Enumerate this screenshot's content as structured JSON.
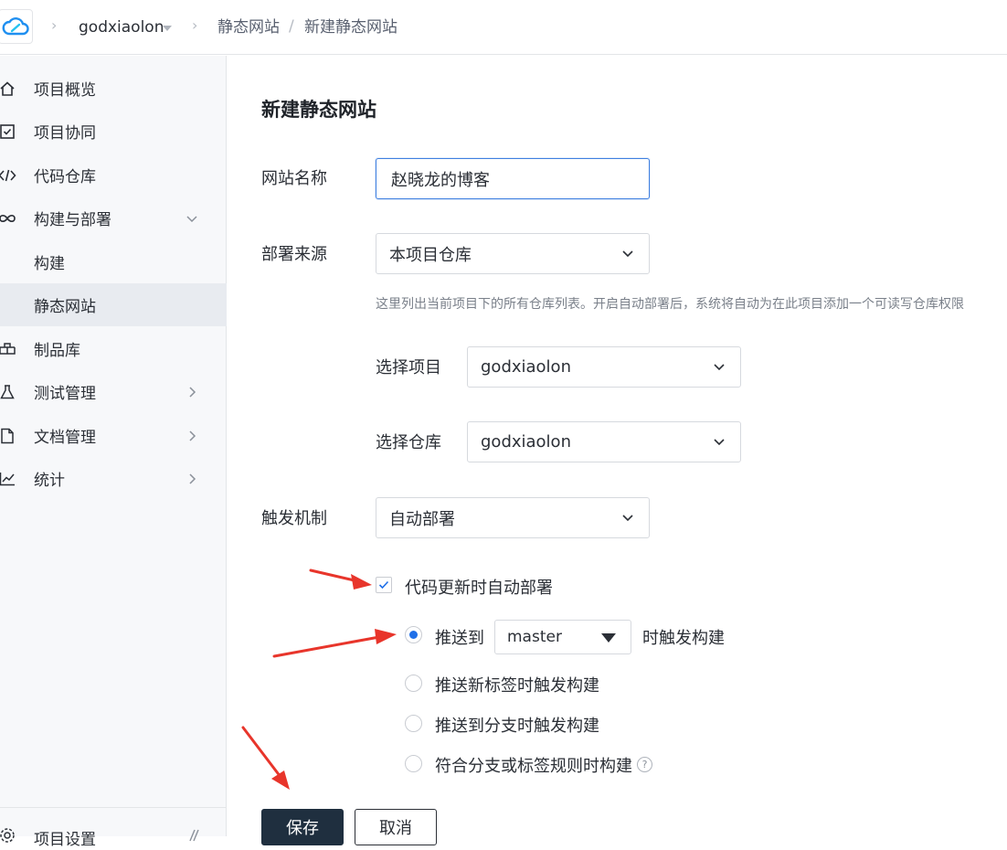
{
  "header": {
    "project_name": "godxiaolon",
    "breadcrumb": [
      "静态网站",
      "新建静态网站"
    ],
    "slash": "/"
  },
  "sidebar": {
    "items": [
      {
        "label": "项目概览",
        "icon": "home-icon"
      },
      {
        "label": "项目协同",
        "icon": "checkbox-icon"
      },
      {
        "label": "代码仓库",
        "icon": "code-icon"
      },
      {
        "label": "构建与部署",
        "icon": "infinity-icon",
        "expanded": true
      },
      {
        "label": "构建",
        "sub": true
      },
      {
        "label": "静态网站",
        "sub": true,
        "active": true
      },
      {
        "label": "制品库",
        "icon": "package-icon"
      },
      {
        "label": "测试管理",
        "icon": "flask-icon"
      },
      {
        "label": "文档管理",
        "icon": "document-icon"
      },
      {
        "label": "统计",
        "icon": "chart-icon"
      }
    ],
    "footer_label": "项目设置"
  },
  "form": {
    "title": "新建静态网站",
    "site_name_label": "网站名称",
    "site_name_value": "赵晓龙的博客",
    "source_label": "部署来源",
    "source_value": "本项目仓库",
    "hint": "这里列出当前项目下的所有仓库列表。开启自动部署后，系统将自动为在此项目添加一个可读写仓库权限",
    "project_label": "选择项目",
    "project_value": "godxiaolon",
    "repo_label": "选择仓库",
    "repo_value": "godxiaolon",
    "trigger_label": "触发机制",
    "trigger_value": "自动部署",
    "auto_deploy_label": "代码更新时自动部署",
    "auto_deploy_checked": true,
    "radio_push_prefix": "推送到",
    "branch_value": "master",
    "radio_push_suffix": "时触发构建",
    "radio_tag": "推送新标签时触发构建",
    "radio_branch": "推送到分支时触发构建",
    "radio_rule": "符合分支或标签规则时构建",
    "help_glyph": "?",
    "save_label": "保存",
    "cancel_label": "取消"
  },
  "colors": {
    "accent": "#1f6fe8",
    "primary_button": "#1f2f3f",
    "annotation_arrow": "#e8352b"
  }
}
